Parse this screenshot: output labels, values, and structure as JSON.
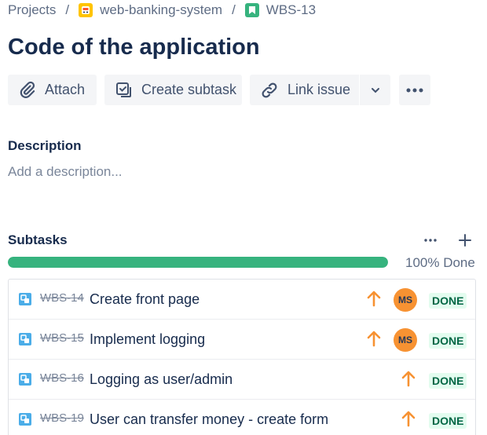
{
  "breadcrumb": {
    "projects": "Projects",
    "separator": "/",
    "project": "web-banking-system",
    "issue_key": "WBS-13"
  },
  "issue": {
    "title": "Code of the application"
  },
  "toolbar": {
    "attach": "Attach",
    "create_subtask": "Create subtask",
    "link_issue": "Link issue"
  },
  "description": {
    "label": "Description",
    "placeholder": "Add a description..."
  },
  "subtasks": {
    "label": "Subtasks",
    "progress_fraction": 1.0,
    "progress_text": "100% Done",
    "colors": {
      "progress": "#36b37e",
      "priority": "#f79232",
      "done_bg": "#e3fcef",
      "done_text": "#006644"
    },
    "items": [
      {
        "key": "WBS-14",
        "summary": "Create front page",
        "priority_icon": "arrow-up-icon",
        "assignee": "MS",
        "status": "DONE"
      },
      {
        "key": "WBS-15",
        "summary": "Implement logging",
        "priority_icon": "arrow-up-icon",
        "assignee": "MS",
        "status": "DONE"
      },
      {
        "key": "WBS-16",
        "summary": "Logging as user/admin",
        "priority_icon": "arrow-up-icon",
        "assignee": "",
        "status": "DONE"
      },
      {
        "key": "WBS-19",
        "summary": "User can transfer money - create form",
        "priority_icon": "arrow-up-icon",
        "assignee": "",
        "status": "DONE"
      }
    ]
  }
}
